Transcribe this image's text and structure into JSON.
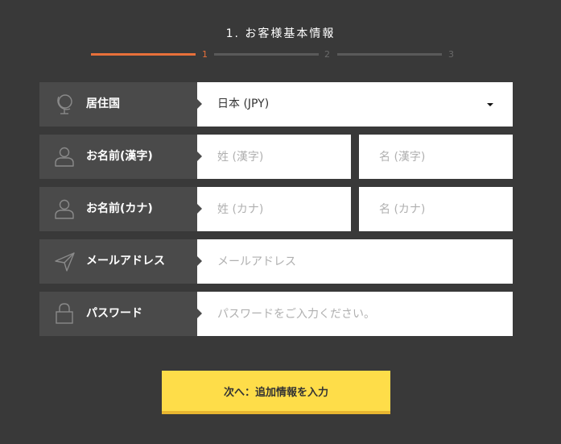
{
  "step": {
    "title": "1. お客様基本情報",
    "numbers": [
      "1",
      "2",
      "3"
    ],
    "active_step": 1
  },
  "form": {
    "residence": {
      "label": "居住国",
      "icon": "globe-icon",
      "selected_value": "日本 (JPY)"
    },
    "name_kanji": {
      "label": "お名前(漢字)",
      "icon": "user-icon",
      "last_placeholder": "姓 (漢字)",
      "first_placeholder": "名 (漢字)"
    },
    "name_kana": {
      "label": "お名前(カナ)",
      "icon": "user-icon",
      "last_placeholder": "姓 (カナ)",
      "first_placeholder": "名 (カナ)"
    },
    "email": {
      "label": "メールアドレス",
      "icon": "paper-plane-icon",
      "placeholder": "メールアドレス"
    },
    "password": {
      "label": "パスワード",
      "icon": "lock-icon",
      "placeholder": "パスワードをご入力ください。"
    }
  },
  "next_button": {
    "label": "次へ：追加情報を入力"
  },
  "colors": {
    "background": "#393939",
    "label_bg": "#4a4a4a",
    "accent_orange": "#e8703a",
    "button_yellow": "#fedd49"
  }
}
